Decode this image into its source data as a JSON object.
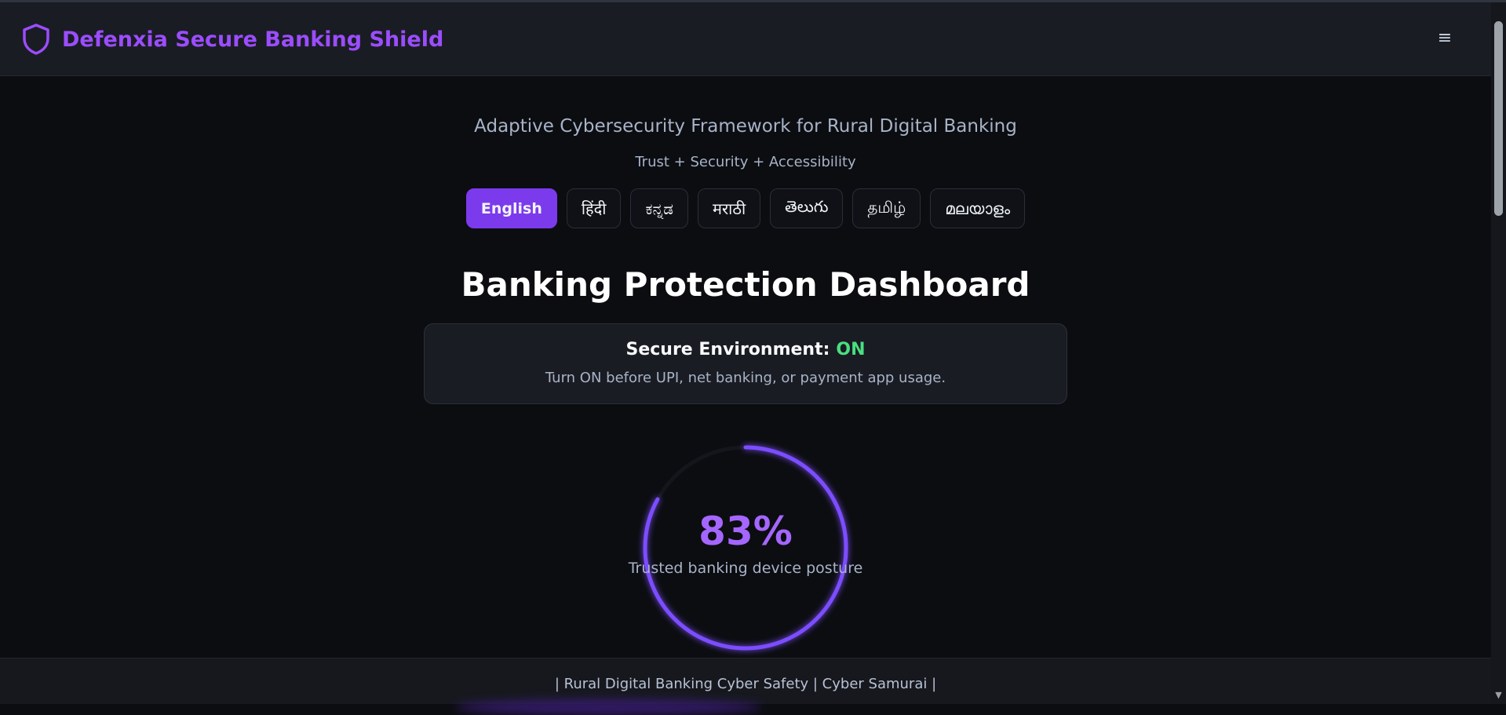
{
  "header": {
    "brand_title": "Defenxia Secure Banking Shield",
    "logo_icon": "shield-icon",
    "menu_icon": "hamburger-menu-icon",
    "menu_glyph": "≡"
  },
  "hero": {
    "tagline": "Adaptive Cybersecurity Framework for Rural Digital Banking",
    "motto": "Trust + Security + Accessibility"
  },
  "languages": [
    {
      "label": "English",
      "active": true
    },
    {
      "label": "हिंदी",
      "active": false
    },
    {
      "label": "ಕನ್ನಡ",
      "active": false
    },
    {
      "label": "मराठी",
      "active": false
    },
    {
      "label": "తెలుగు",
      "active": false
    },
    {
      "label": "தமிழ்",
      "active": false
    },
    {
      "label": "മലയാളം",
      "active": false
    }
  ],
  "dashboard": {
    "title": "Banking Protection Dashboard",
    "secure_label": "Secure Environment:",
    "secure_state": "ON",
    "secure_hint": "Turn ON before UPI, net banking, or payment app usage."
  },
  "posture": {
    "value_text": "83%",
    "fraction": 0.83,
    "label": "Trusted banking device posture"
  },
  "footer": {
    "text": "| Rural Digital Banking Cyber Safety | Cyber Samurai |"
  },
  "colors": {
    "accent": "#7c3aed",
    "brand": "#9b4dff",
    "on_state": "#4ade80",
    "background": "#0c0d11",
    "panel": "#1a1c23"
  },
  "scrollbar": {
    "up_glyph": "▲",
    "down_glyph": "▼"
  }
}
